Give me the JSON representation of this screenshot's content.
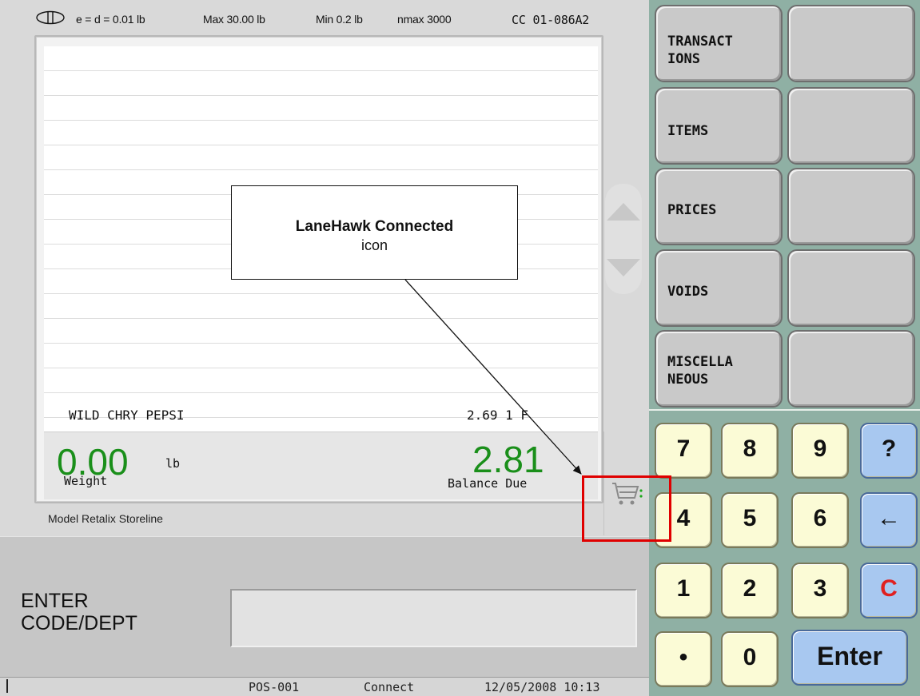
{
  "scale_info": {
    "symbol": "(II)",
    "division": "e = d = 0.01 lb",
    "max": "Max 30.00 lb",
    "min": "Min 0.2 lb",
    "nmax": "nmax 3000",
    "cc": "CC  01-086A2"
  },
  "journal": {
    "last_item": "WILD CHRY PEPSI",
    "last_price": "2.69 1  F"
  },
  "totals": {
    "weight_value": "0.00",
    "weight_unit": "lb",
    "weight_label": "Weight",
    "balance_value": "2.81",
    "balance_label": "Balance Due"
  },
  "model_label": "Model Retalix Storeline",
  "entry": {
    "prompt_line1": "ENTER",
    "prompt_line2": "CODE/DEPT",
    "value": ""
  },
  "status_bar": {
    "terminal": "POS-001",
    "connection": "Connect",
    "datetime": "12/05/2008 10:13"
  },
  "menu": {
    "buttons": [
      {
        "line1": "TRANSACT",
        "line2": "IONS"
      },
      {
        "line1": "",
        "line2": ""
      },
      {
        "line1": "ITEMS",
        "line2": ""
      },
      {
        "line1": "",
        "line2": ""
      },
      {
        "line1": "PRICES",
        "line2": ""
      },
      {
        "line1": "",
        "line2": ""
      },
      {
        "line1": "VOIDS",
        "line2": ""
      },
      {
        "line1": "",
        "line2": ""
      },
      {
        "line1": "MISCELLA",
        "line2": "NEOUS"
      },
      {
        "line1": "",
        "line2": ""
      }
    ]
  },
  "keypad": {
    "k7": "7",
    "k8": "8",
    "k9": "9",
    "help": "?",
    "k4": "4",
    "k5": "5",
    "k6": "6",
    "back": "←",
    "k1": "1",
    "k2": "2",
    "k3": "3",
    "clear": "C",
    "dot": "•",
    "k0": "0",
    "enter": "Enter"
  },
  "colors": {
    "amount_green": "#1a8f1a",
    "clear_key_red": "#e02020",
    "keypad_bg": "#8fb0a4",
    "annotation_red": "#e00000"
  },
  "icons": {
    "scale_symbol": "scale-accuracy-class-icon",
    "connection": "lanehawk-connected-cart-icon"
  },
  "annotation": {
    "title": "LaneHawk Connected",
    "subtitle": "icon"
  }
}
